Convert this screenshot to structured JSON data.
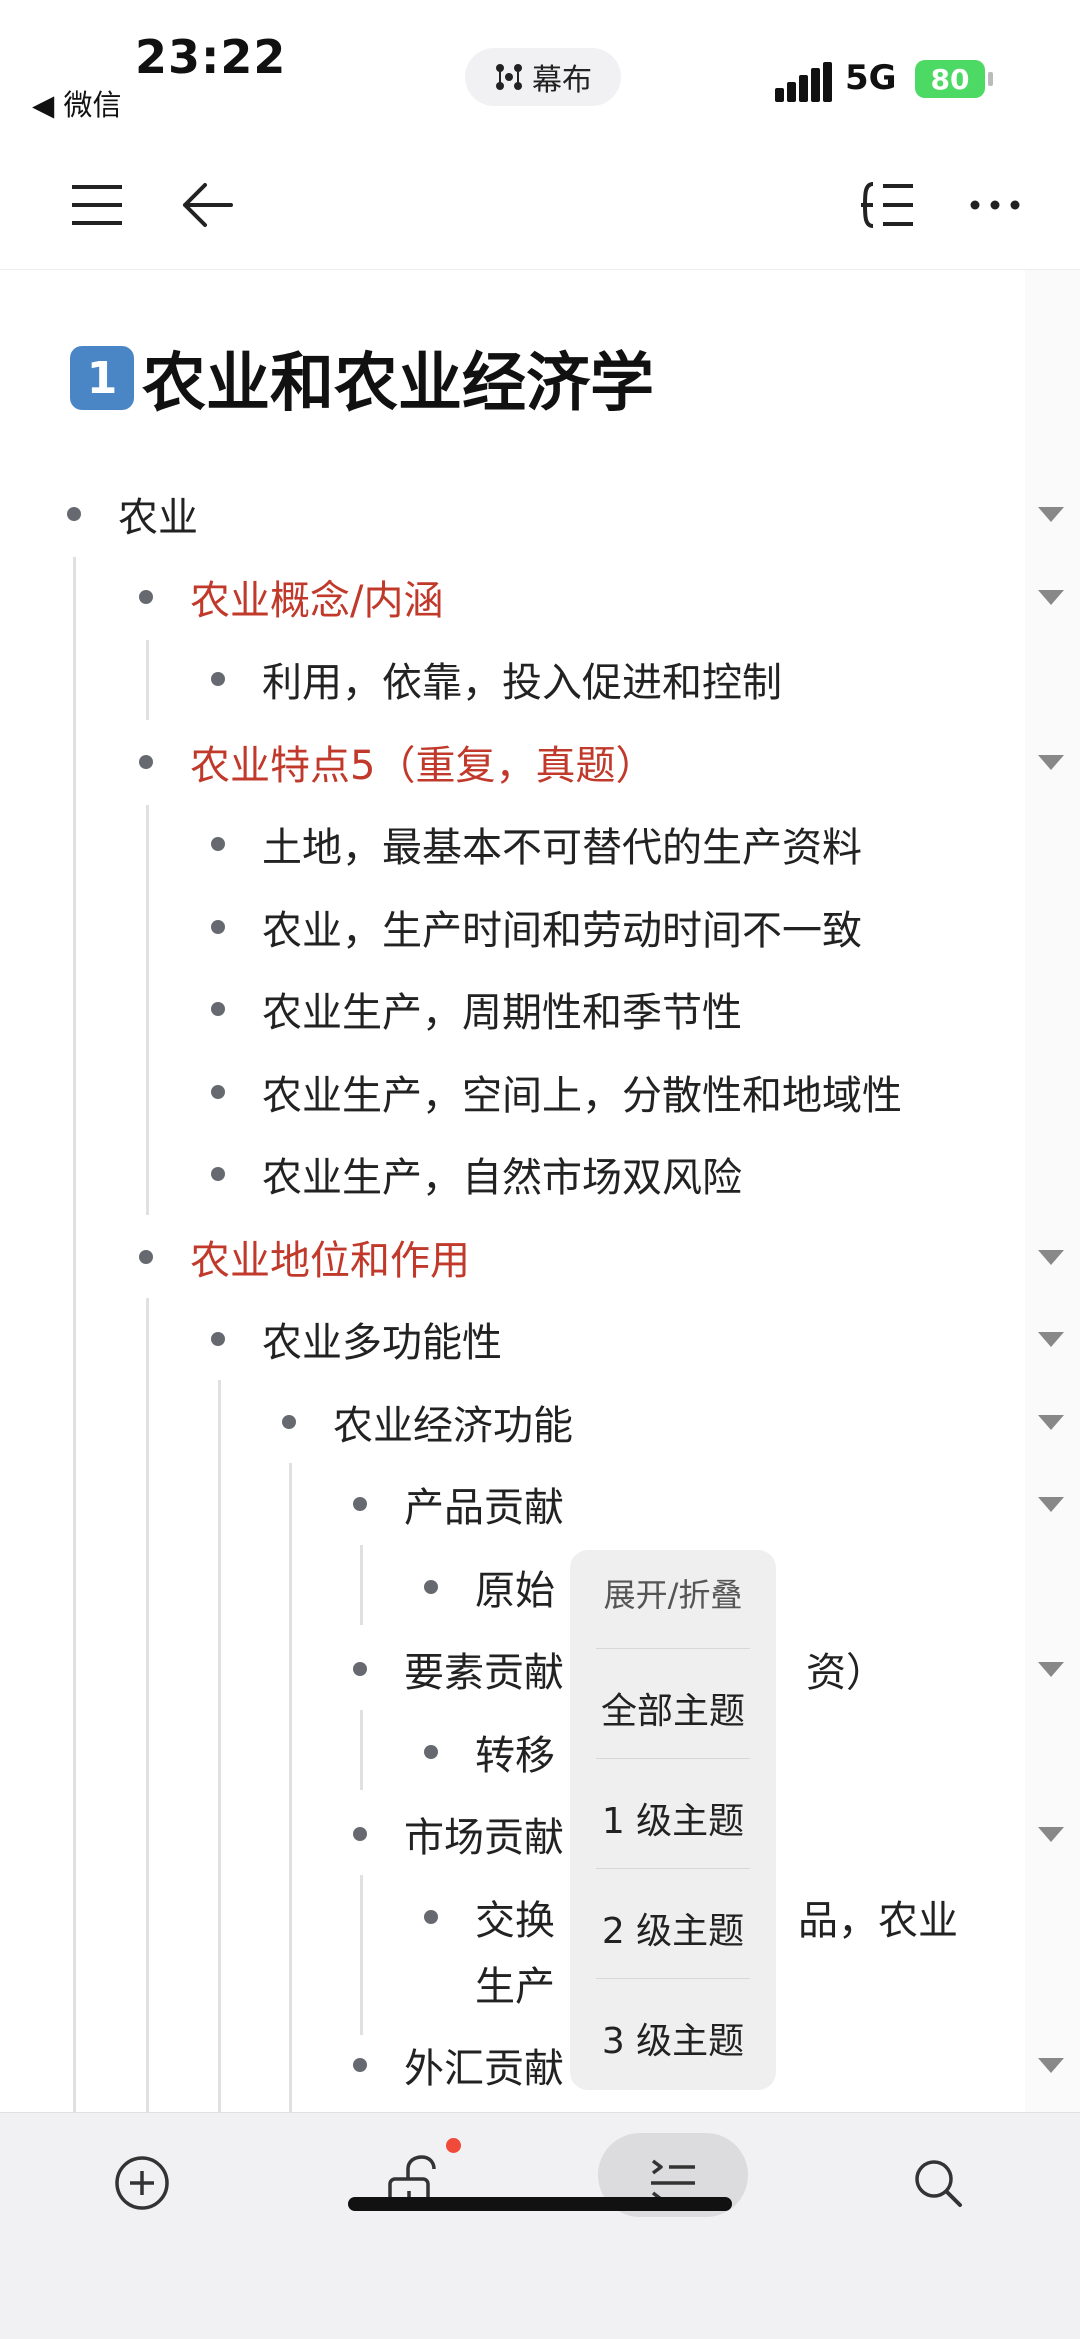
{
  "status": {
    "time": "23:22",
    "back_app": "◀ 微信",
    "app_pill": "幕布",
    "network": "5G",
    "battery": "80"
  },
  "document": {
    "title_badge": "1",
    "title": "农业和农业经济学"
  },
  "outline": [
    {
      "text": "农业",
      "level": 0,
      "red": false
    },
    {
      "text": "农业概念/内涵",
      "level": 1,
      "red": true
    },
    {
      "text": "利用，依靠，投入促进和控制",
      "level": 2,
      "red": false
    },
    {
      "text": "农业特点5（重复，真题）",
      "level": 1,
      "red": true
    },
    {
      "text": "土地，最基本不可替代的生产资料",
      "level": 2,
      "red": false
    },
    {
      "text": "农业，生产时间和劳动时间不一致",
      "level": 2,
      "red": false
    },
    {
      "text": "农业生产，周期性和季节性",
      "level": 2,
      "red": false
    },
    {
      "text": "农业生产，空间上，分散性和地域性",
      "level": 2,
      "red": false
    },
    {
      "text": "农业生产，自然市场双风险",
      "level": 2,
      "red": false
    },
    {
      "text": "农业地位和作用",
      "level": 1,
      "red": true
    },
    {
      "text": "农业多功能性",
      "level": 2,
      "red": false
    },
    {
      "text": "农业经济功能",
      "level": 3,
      "red": false
    },
    {
      "text": "产品贡献",
      "level": 4,
      "red": false
    },
    {
      "text": "原始",
      "level": 5,
      "red": false
    },
    {
      "text": "要素贡献",
      "level": 4,
      "red": false
    },
    {
      "text": "资）",
      "level": 4,
      "red": false
    },
    {
      "text": "转移",
      "level": 5,
      "red": false
    },
    {
      "text": "市场贡献",
      "level": 4,
      "red": false
    },
    {
      "text": "交换",
      "level": 5,
      "red": false
    },
    {
      "text": "品，农业",
      "level": 5,
      "red": false
    },
    {
      "text": "生产",
      "level": 5,
      "red": false
    },
    {
      "text": "外汇贡献",
      "level": 4,
      "red": false
    }
  ],
  "popup": {
    "header": "展开/折叠",
    "items": [
      "全部主题",
      "1 级主题",
      "2 级主题",
      "3 级主题"
    ]
  }
}
